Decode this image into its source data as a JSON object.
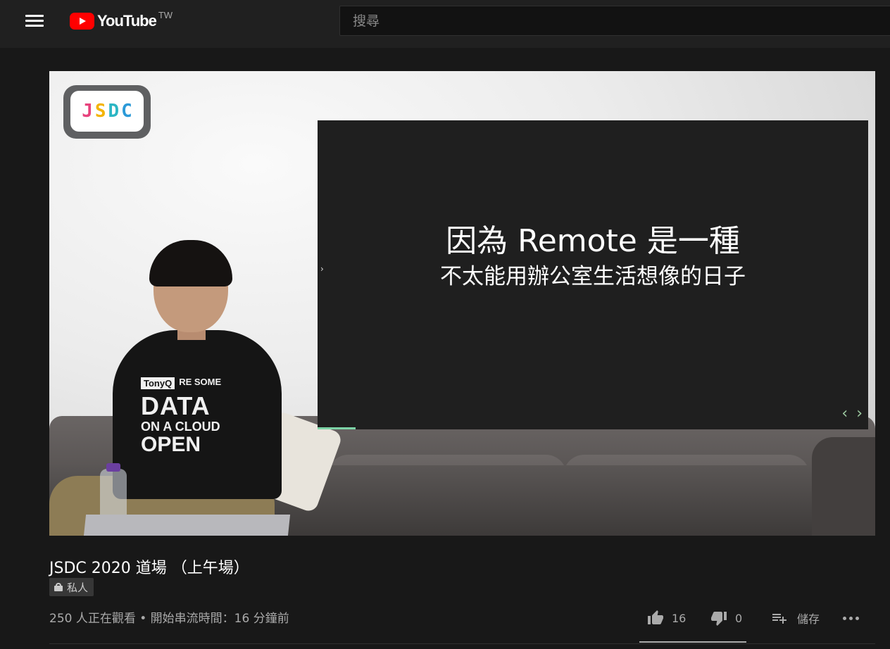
{
  "header": {
    "logo_text": "YouTube",
    "region": "TW",
    "search_placeholder": "搜尋"
  },
  "video": {
    "slide_title": "因為 Remote 是一種",
    "slide_subtitle": "不太能用辦公室生活想像的日子",
    "shirt_tag": "TonyQ",
    "shirt_line1": "RE SOME",
    "shirt_line2": "DATA",
    "shirt_line3": "ON A CLOUD",
    "shirt_line4": "OPEN",
    "brand_letters": [
      "J",
      "S",
      "D",
      "C"
    ]
  },
  "info": {
    "title": "JSDC 2020 道場 （上午場）",
    "privacy": "私人",
    "meta": "250 人正在觀看 • 開始串流時間：16 分鐘前"
  },
  "actions": {
    "like_count": "16",
    "dislike_count": "0",
    "save_label": "儲存",
    "like_ratio": 1.0
  },
  "colors": {
    "brand_red": "#ff0000",
    "background": "#181818",
    "topbar": "#202020"
  },
  "icons": [
    "menu-icon",
    "youtube-logo-icon",
    "lock-icon",
    "thumbs-up-icon",
    "thumbs-down-icon",
    "playlist-add-icon",
    "more-icon"
  ]
}
